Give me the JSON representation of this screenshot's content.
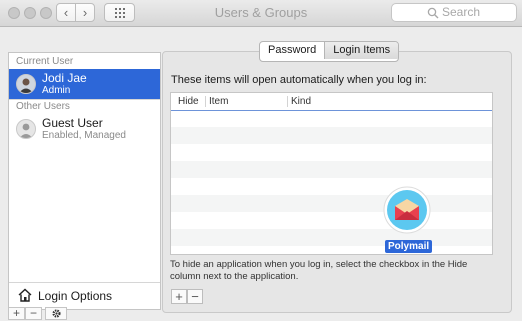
{
  "window": {
    "title": "Users & Groups",
    "search_placeholder": "Search",
    "back_glyph": "‹",
    "forward_glyph": "›"
  },
  "sidebar": {
    "current_user_header": "Current User",
    "current_user": {
      "name": "Jodi Jae",
      "role": "Admin"
    },
    "other_users_header": "Other Users",
    "other_users": [
      {
        "name": "Guest User",
        "status": "Enabled, Managed"
      }
    ],
    "login_options_label": "Login Options",
    "add_glyph": "+",
    "remove_glyph": "−"
  },
  "tabs": [
    {
      "label": "Password",
      "selected": false
    },
    {
      "label": "Login Items",
      "selected": true
    }
  ],
  "login_items": {
    "intro": "These items will open automatically when you log in:",
    "columns": [
      "Hide",
      "Item",
      "Kind"
    ],
    "help": "To hide an application when you log in, select the checkbox in the Hide column next to the application.",
    "add_glyph": "+",
    "remove_glyph": "−"
  },
  "drag_item": {
    "label": "Polymail",
    "icon": "polymail-envelope-icon"
  },
  "colors": {
    "selection": "#2d67d8",
    "table_header_line": "#6d93d9",
    "polymail_circle": "#5cc8f0"
  }
}
